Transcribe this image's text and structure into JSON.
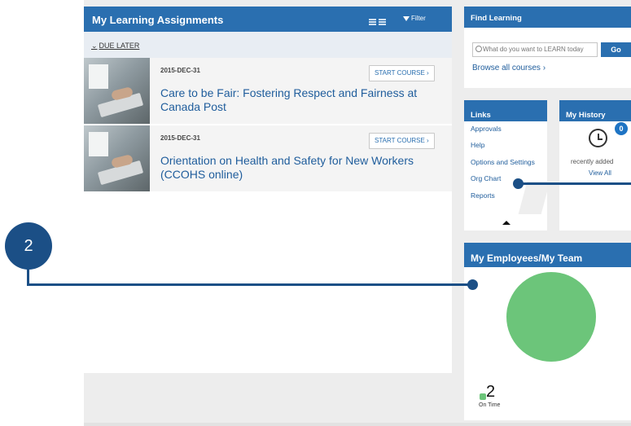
{
  "learning": {
    "title": "My Learning Assignments",
    "filter_label": "Filter",
    "due_label": "DUE LATER",
    "courses": [
      {
        "date": "2015-DEC-31",
        "button": "START COURSE",
        "title": "Care to be Fair: Fostering Respect and Fairness at Canada Post"
      },
      {
        "date": "2015-DEC-31",
        "button": "START COURSE",
        "title": "Orientation on Health and Safety for New Workers (CCOHS online)"
      }
    ]
  },
  "find": {
    "title": "Find Learning",
    "search_placeholder": "What do you want to LEARN today",
    "go_label": "Go",
    "browse_label": "Browse all courses"
  },
  "links": {
    "title": "Links",
    "items": [
      "Approvals",
      "Help",
      "Options and Settings",
      "Org Chart",
      "Reports"
    ]
  },
  "history": {
    "title": "My History",
    "badge": "0",
    "recent_label": "recently added",
    "view_all": "View All"
  },
  "employees": {
    "title": "My Employees/My Team",
    "count": "2",
    "status_label": "On Time"
  },
  "callout": {
    "number": "2"
  },
  "colors": {
    "header_blue": "#2a6fb0",
    "pie_green": "#6cc57a",
    "callout_navy": "#1b4f86"
  }
}
